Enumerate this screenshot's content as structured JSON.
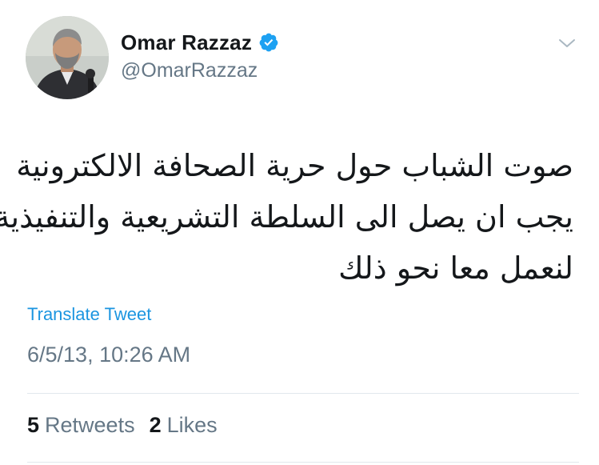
{
  "author": {
    "display_name": "Omar Razzaz",
    "handle": "@OmarRazzaz",
    "verified": true
  },
  "tweet": {
    "text_lines": [
      "صوت الشباب حول حرية الصحافة الالكترونية",
      "يجب ان يصل الى السلطة التشريعية والتنفيذية.",
      "لنعمل معا نحو ذلك"
    ],
    "translate_label": "Translate Tweet",
    "timestamp": "6/5/13, 10:26 AM"
  },
  "stats": {
    "retweets_count": "5",
    "retweets_label": "Retweets",
    "likes_count": "2",
    "likes_label": "Likes"
  },
  "colors": {
    "verified_blue": "#1da1f2",
    "link_blue": "#1b95e0",
    "secondary_text": "#657786",
    "divider": "#e1e8ed"
  },
  "icons": {
    "verified": "verified-badge-icon",
    "menu": "chevron-down-icon"
  }
}
